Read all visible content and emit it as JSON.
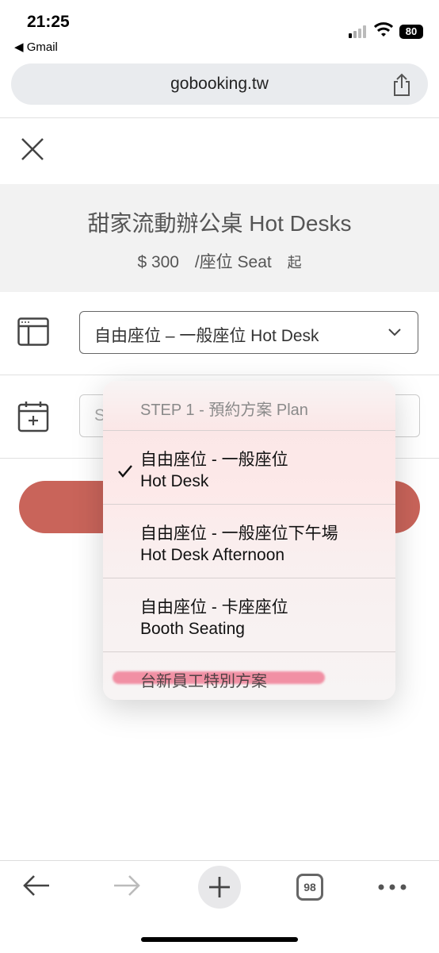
{
  "status_bar": {
    "time": "21:25",
    "back_app": "◀ Gmail",
    "battery": "80"
  },
  "browser": {
    "url": "gobooking.tw",
    "tab_count": "98"
  },
  "product": {
    "title": "甜家流動辦公桌 Hot Desks",
    "price": "$ 300",
    "unit": "/座位 Seat",
    "from": "起"
  },
  "form": {
    "plan_selected": "自由座位 – 一般座位 Hot Desk",
    "date_placeholder": "S"
  },
  "dropdown": {
    "header": "STEP 1 - 預約方案 Plan",
    "options": [
      {
        "line1": "自由座位 - 一般座位",
        "line2": "Hot Desk",
        "selected": true
      },
      {
        "line1": "自由座位 - 一般座位下午場",
        "line2": "Hot Desk Afternoon",
        "selected": false
      },
      {
        "line1": "自由座位 - 卡座座位",
        "line2": "Booth Seating",
        "selected": false
      }
    ],
    "last_option": "台新員工特別方案"
  },
  "colors": {
    "accent": "#c9645a",
    "header_bg": "#f2f2f2",
    "redaction": "#ef6f8a"
  }
}
